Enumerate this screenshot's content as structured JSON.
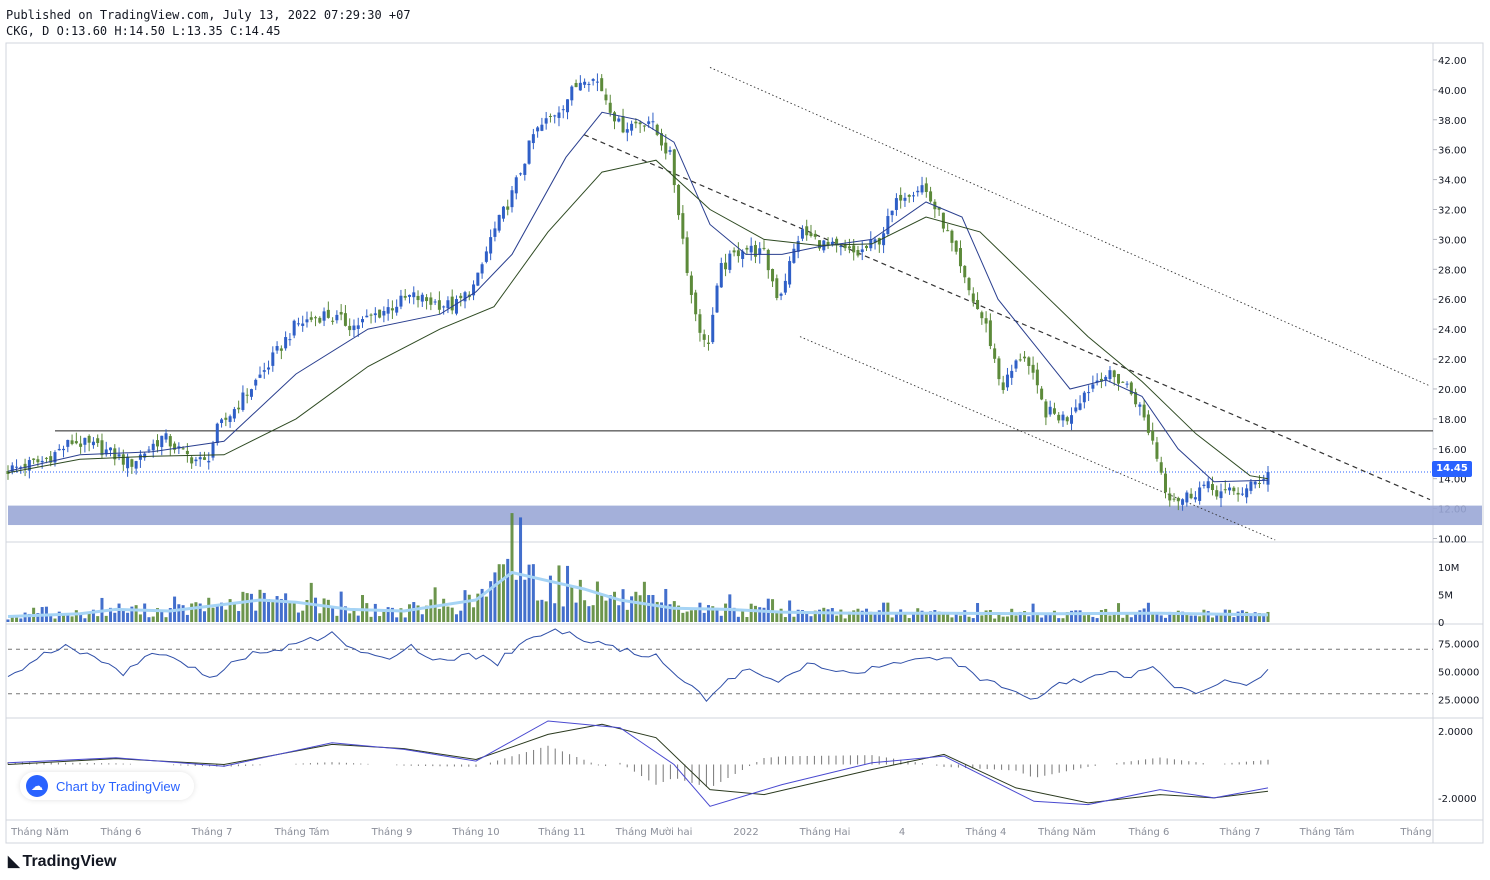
{
  "header": {
    "published": "Published on TradingView.com, July 13, 2022 07:29:30 +07",
    "ohlc": "CKG, D O:13.60 H:14.50 L:13.35 C:14.45"
  },
  "last_price_label": "14.45",
  "watermark": {
    "badge": "Chart by TradingView",
    "logo": "TradingView"
  },
  "colors": {
    "up": "#2f5fc7",
    "down": "#5c8a3a",
    "volume_ma": "#a6d4f5",
    "zone": "#9aa7d6",
    "rsi": "#2f4fa8"
  },
  "chart_data": {
    "type": "candlestick",
    "symbol": "CKG",
    "interval": "D",
    "ohlc_last": {
      "open": 13.6,
      "high": 14.5,
      "low": 13.35,
      "close": 14.45
    },
    "price_axis": {
      "ticks": [
        "10.00",
        "12.00",
        "14.00",
        "16.00",
        "18.00",
        "20.00",
        "22.00",
        "24.00",
        "26.00",
        "28.00",
        "30.00",
        "32.00",
        "34.00",
        "36.00",
        "38.00",
        "40.00",
        "42.00"
      ],
      "ylim": [
        9.9,
        43.0
      ]
    },
    "volume_axis": {
      "ticks": [
        "0",
        "5M",
        "10M"
      ],
      "ylim": [
        0,
        14
      ]
    },
    "rsi_axis": {
      "ticks": [
        "25.0000",
        "50.0000",
        "75.0000"
      ],
      "ylim": [
        10,
        90
      ],
      "bands": [
        30,
        70
      ]
    },
    "macd_axis": {
      "ticks": [
        "-2.0000",
        "2.0000"
      ],
      "ylim": [
        -3.2,
        2.6
      ]
    },
    "x_labels": [
      "Tháng Năm",
      "Tháng 6",
      "Tháng 7",
      "Tháng Tám",
      "Tháng 9",
      "Tháng 10",
      "Tháng 11",
      "Tháng Mười hai",
      "2022",
      "Tháng Hai",
      "4",
      "Tháng 4",
      "Tháng Năm",
      "Tháng 6",
      "Tháng 7",
      "Tháng Tám",
      "Tháng"
    ],
    "close_path": [
      [
        0,
        14.6
      ],
      [
        10,
        15.2
      ],
      [
        18,
        16.5
      ],
      [
        26,
        16.0
      ],
      [
        34,
        15.0
      ],
      [
        43,
        16.8
      ],
      [
        49,
        15.6
      ],
      [
        55,
        15.0
      ],
      [
        58,
        17.2
      ],
      [
        64,
        19.0
      ],
      [
        72,
        21.5
      ],
      [
        80,
        24.3
      ],
      [
        88,
        25.0
      ],
      [
        96,
        24.2
      ],
      [
        104,
        25.2
      ],
      [
        112,
        26.2
      ],
      [
        118,
        25.8
      ],
      [
        124,
        25.5
      ],
      [
        130,
        27.0
      ],
      [
        134,
        30.0
      ],
      [
        140,
        33.0
      ],
      [
        146,
        37.0
      ],
      [
        154,
        39.0
      ],
      [
        160,
        41.0
      ],
      [
        164,
        40.5
      ],
      [
        170,
        37.5
      ],
      [
        178,
        38.0
      ],
      [
        184,
        35.5
      ],
      [
        190,
        26.0
      ],
      [
        194,
        22.5
      ],
      [
        198,
        28.0
      ],
      [
        204,
        29.5
      ],
      [
        210,
        29.0
      ],
      [
        214,
        26.0
      ],
      [
        220,
        30.5
      ],
      [
        228,
        29.5
      ],
      [
        236,
        29.0
      ],
      [
        242,
        30.0
      ],
      [
        248,
        33.0
      ],
      [
        254,
        33.6
      ],
      [
        260,
        31.0
      ],
      [
        266,
        27.0
      ],
      [
        272,
        24.0
      ],
      [
        276,
        20.0
      ],
      [
        282,
        22.5
      ],
      [
        288,
        18.5
      ],
      [
        294,
        18.0
      ],
      [
        298,
        19.5
      ],
      [
        304,
        21.0
      ],
      [
        310,
        20.5
      ],
      [
        314,
        19.0
      ],
      [
        318,
        16.5
      ],
      [
        322,
        13.0
      ],
      [
        326,
        12.6
      ],
      [
        332,
        13.5
      ],
      [
        338,
        13.0
      ],
      [
        344,
        13.2
      ],
      [
        350,
        14.45
      ]
    ],
    "moving_averages": [
      {
        "period": "short",
        "points": [
          [
            0,
            14.5
          ],
          [
            20,
            15.6
          ],
          [
            40,
            15.8
          ],
          [
            60,
            16.5
          ],
          [
            80,
            21.0
          ],
          [
            100,
            24.0
          ],
          [
            120,
            25.0
          ],
          [
            130,
            26.5
          ],
          [
            140,
            29.0
          ],
          [
            155,
            35.5
          ],
          [
            165,
            38.5
          ],
          [
            175,
            38.0
          ],
          [
            185,
            36.5
          ],
          [
            195,
            31.0
          ],
          [
            205,
            29.0
          ],
          [
            215,
            29.0
          ],
          [
            225,
            29.5
          ],
          [
            240,
            30.0
          ],
          [
            255,
            32.5
          ],
          [
            265,
            31.5
          ],
          [
            275,
            26.0
          ],
          [
            285,
            23.0
          ],
          [
            295,
            20.0
          ],
          [
            305,
            20.6
          ],
          [
            315,
            19.5
          ],
          [
            325,
            16.0
          ],
          [
            335,
            13.8
          ],
          [
            350,
            13.9
          ]
        ]
      },
      {
        "period": "long",
        "points": [
          [
            0,
            14.4
          ],
          [
            20,
            15.3
          ],
          [
            40,
            15.5
          ],
          [
            60,
            15.6
          ],
          [
            80,
            18.0
          ],
          [
            100,
            21.5
          ],
          [
            120,
            24.0
          ],
          [
            135,
            25.5
          ],
          [
            150,
            30.5
          ],
          [
            165,
            34.5
          ],
          [
            180,
            35.3
          ],
          [
            195,
            32.0
          ],
          [
            210,
            30.0
          ],
          [
            225,
            29.6
          ],
          [
            240,
            29.7
          ],
          [
            255,
            31.5
          ],
          [
            270,
            30.5
          ],
          [
            285,
            27.0
          ],
          [
            300,
            23.5
          ],
          [
            315,
            20.5
          ],
          [
            330,
            17.0
          ],
          [
            345,
            14.2
          ],
          [
            350,
            14.0
          ]
        ]
      }
    ],
    "horizontal_levels": [
      17.2
    ],
    "last_price_line": 14.45,
    "support_zone": [
      10.9,
      12.2
    ],
    "trendlines": [
      {
        "style": "dotted",
        "from": [
          195,
          41.5
        ],
        "to": [
          395,
          20.2
        ]
      },
      {
        "style": "dashed",
        "from": [
          160,
          37.0
        ],
        "to": [
          395,
          12.6
        ]
      },
      {
        "style": "dotted",
        "from": [
          220,
          23.5
        ],
        "to": [
          352,
          9.9
        ]
      }
    ],
    "volume_path": [
      [
        0,
        1.0
      ],
      [
        20,
        1.5
      ],
      [
        30,
        2.3
      ],
      [
        45,
        2.0
      ],
      [
        55,
        2.8
      ],
      [
        70,
        4.0
      ],
      [
        80,
        3.6
      ],
      [
        95,
        2.3
      ],
      [
        110,
        2.0
      ],
      [
        130,
        4.0
      ],
      [
        140,
        9.0
      ],
      [
        150,
        7.5
      ],
      [
        160,
        6.0
      ],
      [
        170,
        4.0
      ],
      [
        185,
        2.5
      ],
      [
        200,
        2.3
      ],
      [
        215,
        1.8
      ],
      [
        235,
        1.6
      ],
      [
        260,
        1.6
      ],
      [
        290,
        1.5
      ],
      [
        320,
        1.6
      ],
      [
        350,
        1.3
      ]
    ],
    "rsi_path": [
      [
        0,
        45
      ],
      [
        8,
        62
      ],
      [
        16,
        72
      ],
      [
        24,
        62
      ],
      [
        32,
        48
      ],
      [
        40,
        68
      ],
      [
        48,
        60
      ],
      [
        56,
        44
      ],
      [
        64,
        63
      ],
      [
        72,
        68
      ],
      [
        82,
        76
      ],
      [
        90,
        84
      ],
      [
        96,
        70
      ],
      [
        104,
        60
      ],
      [
        112,
        72
      ],
      [
        120,
        60
      ],
      [
        128,
        66
      ],
      [
        136,
        58
      ],
      [
        144,
        80
      ],
      [
        152,
        86
      ],
      [
        160,
        80
      ],
      [
        170,
        70
      ],
      [
        180,
        64
      ],
      [
        188,
        42
      ],
      [
        194,
        26
      ],
      [
        200,
        44
      ],
      [
        206,
        52
      ],
      [
        214,
        38
      ],
      [
        222,
        58
      ],
      [
        230,
        52
      ],
      [
        238,
        50
      ],
      [
        246,
        58
      ],
      [
        254,
        64
      ],
      [
        262,
        62
      ],
      [
        270,
        44
      ],
      [
        278,
        32
      ],
      [
        286,
        24
      ],
      [
        292,
        38
      ],
      [
        300,
        44
      ],
      [
        306,
        50
      ],
      [
        312,
        46
      ],
      [
        318,
        52
      ],
      [
        324,
        38
      ],
      [
        330,
        28
      ],
      [
        338,
        42
      ],
      [
        344,
        40
      ],
      [
        350,
        50
      ]
    ],
    "macd_path": [
      [
        0,
        0.1
      ],
      [
        30,
        0.4
      ],
      [
        60,
        -0.1
      ],
      [
        90,
        1.3
      ],
      [
        110,
        0.9
      ],
      [
        130,
        0.2
      ],
      [
        150,
        2.6
      ],
      [
        170,
        2.2
      ],
      [
        185,
        0.0
      ],
      [
        195,
        -2.5
      ],
      [
        215,
        -1.2
      ],
      [
        240,
        0.1
      ],
      [
        260,
        0.5
      ],
      [
        285,
        -2.2
      ],
      [
        300,
        -2.4
      ],
      [
        320,
        -1.5
      ],
      [
        335,
        -2.0
      ],
      [
        350,
        -1.4
      ]
    ],
    "signal_path": [
      [
        0,
        0.0
      ],
      [
        30,
        0.35
      ],
      [
        60,
        0.0
      ],
      [
        90,
        1.2
      ],
      [
        110,
        0.95
      ],
      [
        130,
        0.3
      ],
      [
        150,
        1.8
      ],
      [
        165,
        2.4
      ],
      [
        180,
        1.6
      ],
      [
        195,
        -1.5
      ],
      [
        210,
        -1.8
      ],
      [
        240,
        -0.3
      ],
      [
        260,
        0.6
      ],
      [
        280,
        -1.4
      ],
      [
        300,
        -2.3
      ],
      [
        320,
        -1.8
      ],
      [
        335,
        -2.0
      ],
      [
        350,
        -1.6
      ]
    ]
  }
}
